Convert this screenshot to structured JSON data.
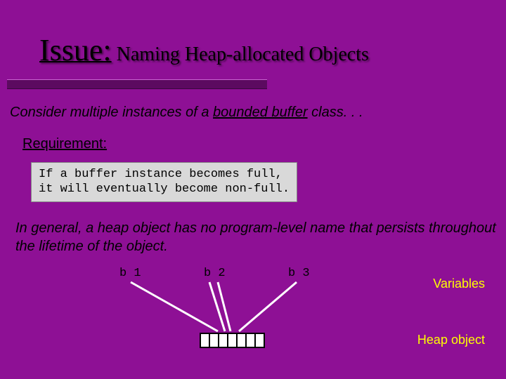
{
  "title": {
    "issue": "Issue:",
    "rest": " Naming Heap-allocated Objects"
  },
  "para1": {
    "before": "Consider multiple instances of a ",
    "bounded": "bounded buffer",
    "after": " class. . ."
  },
  "requirement": {
    "label": "Requirement:",
    "line1_kw": "If",
    "line1_rest": " a buffer instance becomes full,",
    "line2_kw": "it",
    "line2_rest": " will eventually become non-full."
  },
  "para2": "In general, a heap object has no program-level name that persists throughout the lifetime of the object.",
  "diagram": {
    "vars": [
      "b 1",
      "b 2",
      "b 3"
    ],
    "right_variables": "Variables",
    "right_heap": "Heap object"
  }
}
